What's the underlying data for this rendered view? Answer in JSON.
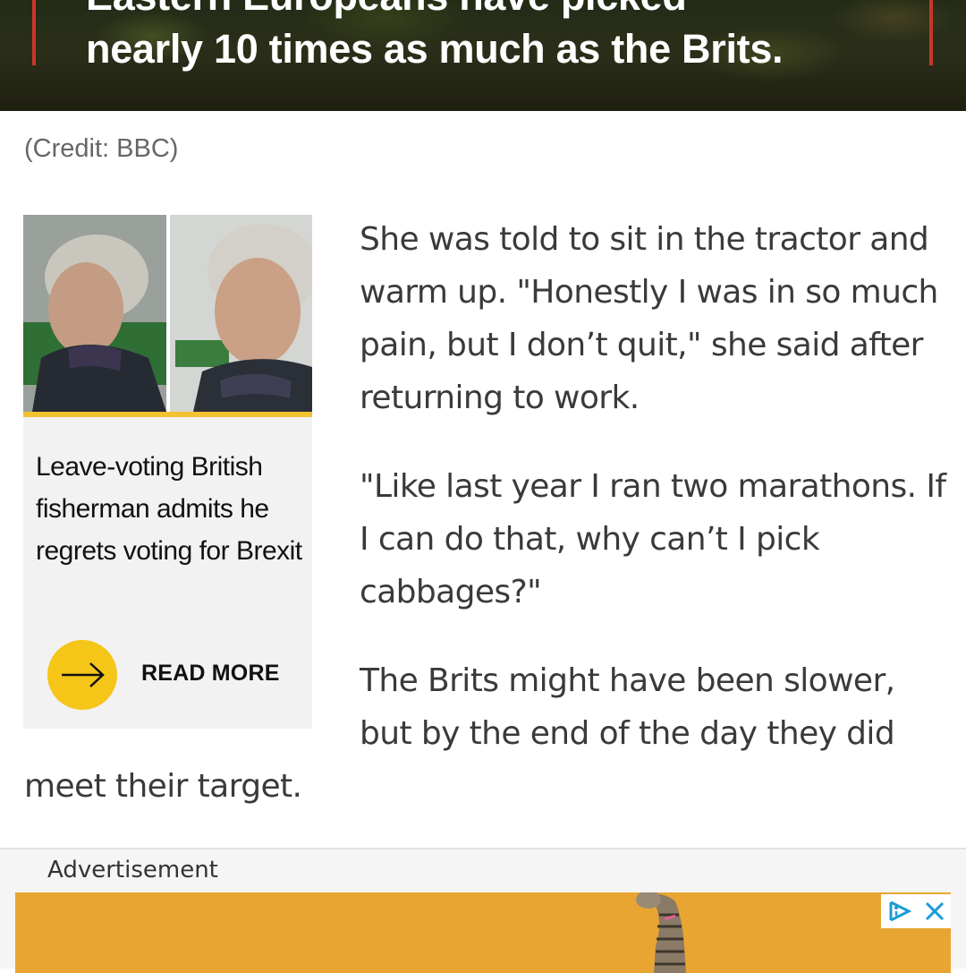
{
  "hero": {
    "line1": "Eastern Europeans have picked",
    "line2": "nearly 10 times as much as the Brits.",
    "accent_color": "#c8372a"
  },
  "credit": "(Credit: BBC)",
  "related": {
    "title": "Leave-voting British fisherman admits he regrets voting for Brexit",
    "read_more_label": "READ MORE",
    "icon": "arrow-right-icon",
    "accent_color": "#f5c518"
  },
  "article": {
    "paragraph1": "She was told to sit in the tractor and warm up. \"Honestly I was in so much pain, but I don’t quit,\" she said after returning to work.",
    "paragraph2": "\"Like last year I ran two marathons. If I can do that, why can’t I pick cabbages?\"",
    "paragraph3_start": "The Brits might have been slower, but by the end of the day they did",
    "paragraph3_end": "meet their target."
  },
  "ad": {
    "label": "Advertisement",
    "banner_color": "#e9a532",
    "choices_icon": "adchoices-icon",
    "close_icon": "close-icon"
  }
}
